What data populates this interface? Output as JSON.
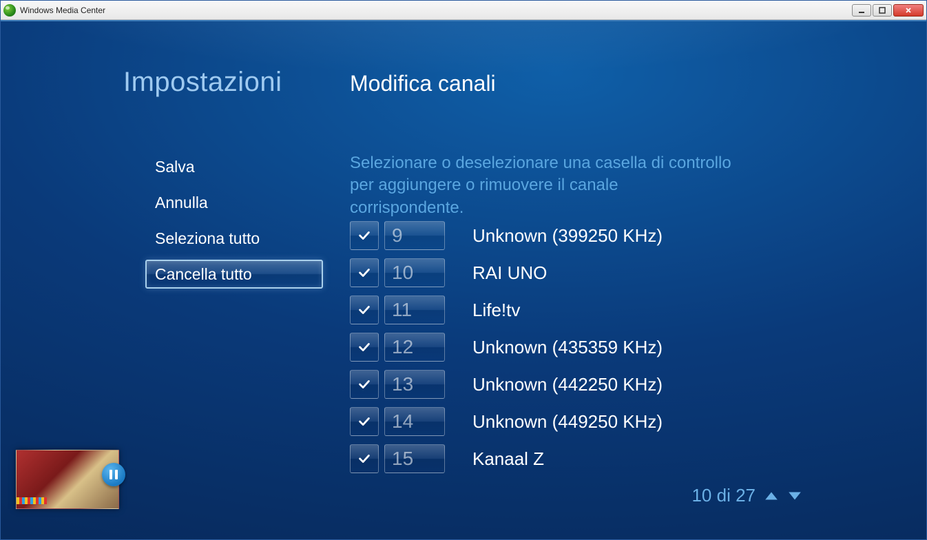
{
  "window": {
    "title": "Windows Media Center"
  },
  "headings": {
    "settings": "Impostazioni",
    "page": "Modifica canali"
  },
  "menu": {
    "items": [
      {
        "label": "Salva",
        "selected": false
      },
      {
        "label": "Annulla",
        "selected": false
      },
      {
        "label": "Seleziona tutto",
        "selected": false
      },
      {
        "label": "Cancella tutto",
        "selected": true
      }
    ]
  },
  "instructions": "Selezionare o deselezionare una casella di controllo per aggiungere o rimuovere il canale corrispondente.",
  "channels": [
    {
      "checked": true,
      "number": "9",
      "name": "Unknown (399250 KHz)"
    },
    {
      "checked": true,
      "number": "10",
      "name": "RAI UNO"
    },
    {
      "checked": true,
      "number": "11",
      "name": "Life!tv"
    },
    {
      "checked": true,
      "number": "12",
      "name": "Unknown (435359 KHz)"
    },
    {
      "checked": true,
      "number": "13",
      "name": "Unknown (442250 KHz)"
    },
    {
      "checked": true,
      "number": "14",
      "name": "Unknown (449250 KHz)"
    },
    {
      "checked": true,
      "number": "15",
      "name": "Kanaal Z"
    }
  ],
  "pager": {
    "text": "10 di 27"
  }
}
